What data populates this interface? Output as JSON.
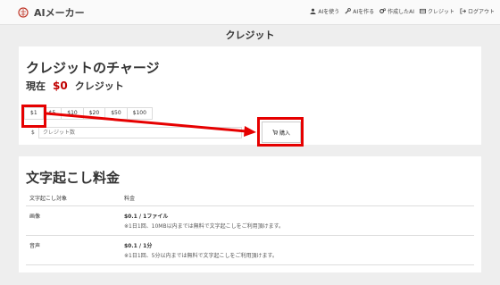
{
  "navbar": {
    "brand": "AIメーカー",
    "items": [
      {
        "label": "AIを使う",
        "icon": "user-icon"
      },
      {
        "label": "AIを作る",
        "icon": "wrench-icon"
      },
      {
        "label": "作成したAI",
        "icon": "gears-icon"
      },
      {
        "label": "クレジット",
        "icon": "card-icon"
      },
      {
        "label": "ログアウト",
        "icon": "logout-icon"
      }
    ]
  },
  "page": {
    "title": "クレジット"
  },
  "charge": {
    "heading": "クレジットのチャージ",
    "current_label": "現在",
    "current_amount": "$0",
    "current_suffix": "クレジット",
    "amounts": [
      "$1",
      "$5",
      "$10",
      "$20",
      "$50",
      "$100"
    ],
    "input_prefix": "$",
    "input_placeholder": "クレジット数",
    "buy_label": "購入"
  },
  "fees": {
    "heading": "文字起こし料金",
    "columns": [
      "文字起こし対象",
      "料金"
    ],
    "rows": [
      {
        "target": "画像",
        "price": "$0.1 / 1ファイル",
        "note": "※1日1回、10MB以内までは無料で文字起こしをご利用頂けます。"
      },
      {
        "target": "音声",
        "price": "$0.1 / 1分",
        "note": "※1日1回、5分以内までは無料で文字起こしをご利用頂けます。"
      }
    ]
  },
  "colors": {
    "accent": "#c00000",
    "highlight": "#e60000"
  }
}
